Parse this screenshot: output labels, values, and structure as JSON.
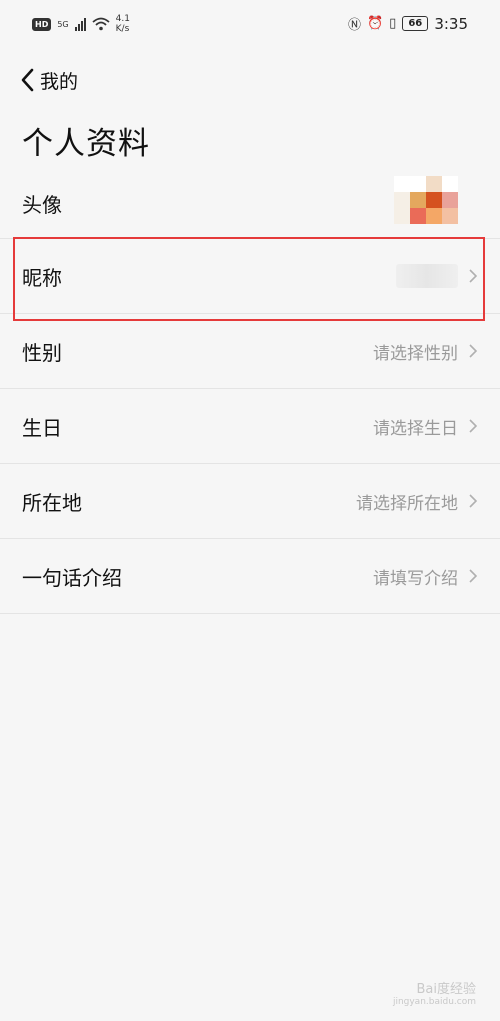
{
  "status_bar": {
    "hd": "HD",
    "network": "5G",
    "speed_value": "4.1",
    "speed_unit": "K/s",
    "battery": "66",
    "time": "3:35"
  },
  "nav": {
    "back_label": "我的"
  },
  "page": {
    "title": "个人资料"
  },
  "rows": [
    {
      "label": "头像",
      "value": ""
    },
    {
      "label": "昵称",
      "value": ""
    },
    {
      "label": "性别",
      "value": "请选择性别"
    },
    {
      "label": "生日",
      "value": "请选择生日"
    },
    {
      "label": "所在地",
      "value": "请选择所在地"
    },
    {
      "label": "一句话介绍",
      "value": "请填写介绍"
    }
  ],
  "colors": {
    "highlight": "#e53a3a",
    "placeholder_text": "#9a9a9a"
  },
  "watermark": {
    "text": "Bai度经验",
    "sub": "jingyan.baidu.com"
  }
}
